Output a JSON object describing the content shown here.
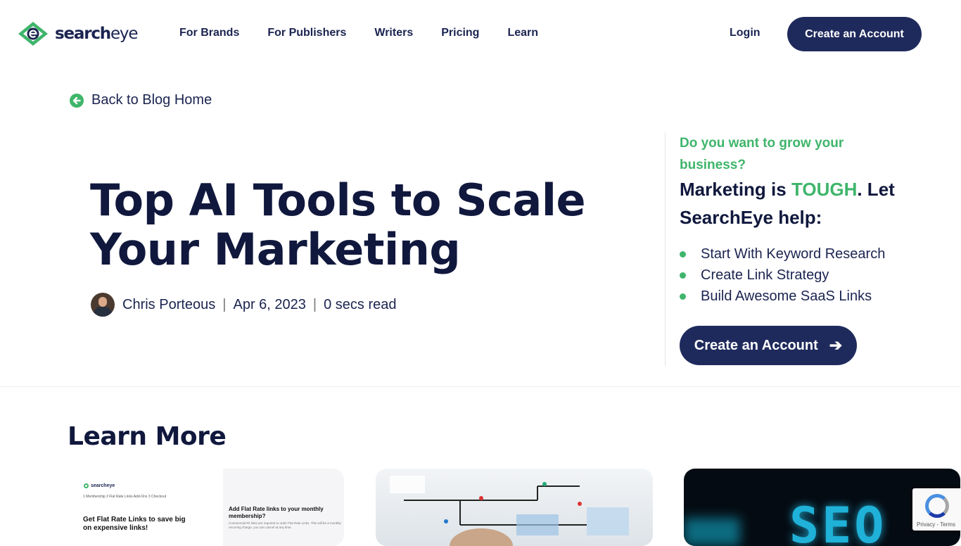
{
  "brand": {
    "name_bold": "search",
    "name_rest": "eye"
  },
  "nav": {
    "links": [
      "For Brands",
      "For Publishers",
      "Writers",
      "Pricing",
      "Learn"
    ],
    "login": "Login",
    "cta": "Create an Account"
  },
  "back": {
    "label": "Back to Blog Home"
  },
  "article": {
    "title": "Top AI Tools to Scale Your Marketing",
    "author": "Chris Porteous",
    "date": "Apr 6, 2023",
    "read_time": "0 secs read"
  },
  "sidebar": {
    "question": "Do you want to grow your business?",
    "headline_pre": "Marketing is ",
    "headline_highlight": "TOUGH",
    "headline_post": ". Let SearchEye help:",
    "items": [
      "Start With Keyword Research",
      "Create Link Strategy",
      "Build Awesome SaaS Links"
    ],
    "cta": "Create an Account"
  },
  "learn_more": {
    "heading": "Learn More",
    "card1": {
      "logo": "searcheye",
      "steps": "1 Membership  2 Flat Rate Links Add-Ons  3 Checkout",
      "headline": "Get Flat Rate Links to save big on expensive links!",
      "right_headline": "Add Flat Rate links to your monthly membership?",
      "right_sub": "Commercial-Fit links are required to order Flat Rate Links. This will be a monthly recurring charge, you can cancel at any time."
    },
    "card3": {
      "text": "SEO"
    }
  },
  "recaptcha": {
    "text": "Privacy - Terms"
  },
  "colors": {
    "navy": "#1f2a5c",
    "green": "#3fb56b",
    "title": "#10183d"
  }
}
